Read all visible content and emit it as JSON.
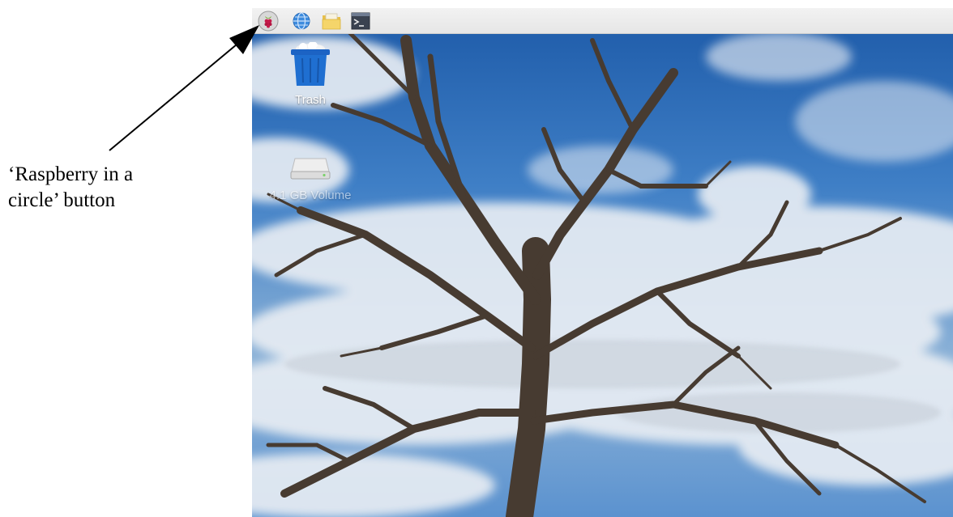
{
  "callout": {
    "line1": "‘Raspberry in a",
    "line2": "circle’ button"
  },
  "taskbar": {
    "items": [
      {
        "icon": "raspberry-menu-icon"
      },
      {
        "icon": "globe-icon"
      },
      {
        "icon": "folder-icon"
      },
      {
        "icon": "terminal-icon"
      }
    ]
  },
  "desktop": {
    "items": [
      {
        "label": "Trash",
        "icon": "trash-icon"
      },
      {
        "label": "4.1 GB Volume",
        "icon": "drive-icon"
      }
    ]
  },
  "colors": {
    "sky_top": "#1f5fb0",
    "sky_bottom": "#6fa6dc",
    "cloud": "#e9eef4",
    "tree": "#4a3f36",
    "trash_blue": "#1f6fd1",
    "raspberry_red": "#c51a4a",
    "leaf_green": "#75a928"
  }
}
